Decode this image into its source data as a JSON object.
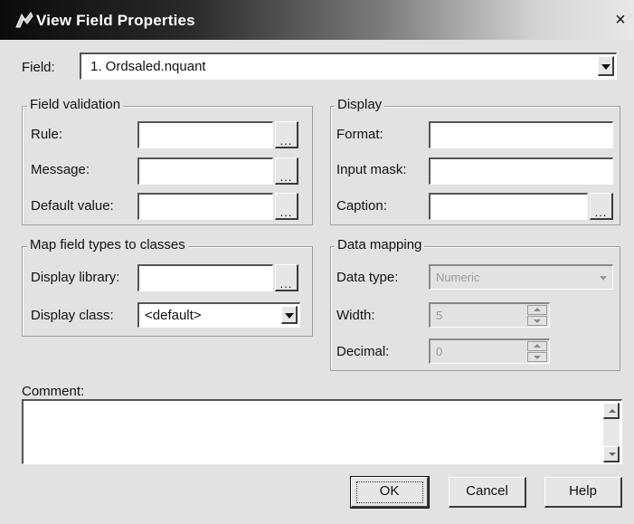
{
  "window": {
    "title": "View Field Properties",
    "close_glyph": "×"
  },
  "field": {
    "label": "Field:",
    "value": "1. Ordsaled.nquant"
  },
  "field_validation": {
    "group_title": "Field validation",
    "rule_label": "Rule:",
    "message_label": "Message:",
    "default_label": "Default value:"
  },
  "display": {
    "group_title": "Display",
    "format_label": "Format:",
    "input_mask_label": "Input mask:",
    "caption_label": "Caption:"
  },
  "map_field": {
    "group_title": "Map field types to classes",
    "library_label": "Display library:",
    "class_label": "Display class:",
    "class_value": "<default>"
  },
  "data_mapping": {
    "group_title": "Data mapping",
    "type_label": "Data type:",
    "type_value": "Numeric",
    "width_label": "Width:",
    "width_value": "5",
    "decimal_label": "Decimal:",
    "decimal_value": "0"
  },
  "comment": {
    "label": "Comment:"
  },
  "buttons": {
    "ok": "OK",
    "cancel": "Cancel",
    "help": "Help",
    "ellipsis": "..."
  },
  "icons": {
    "title_icon": "app-icon",
    "close": "close-icon",
    "dropdown": "chevron-down-icon"
  }
}
